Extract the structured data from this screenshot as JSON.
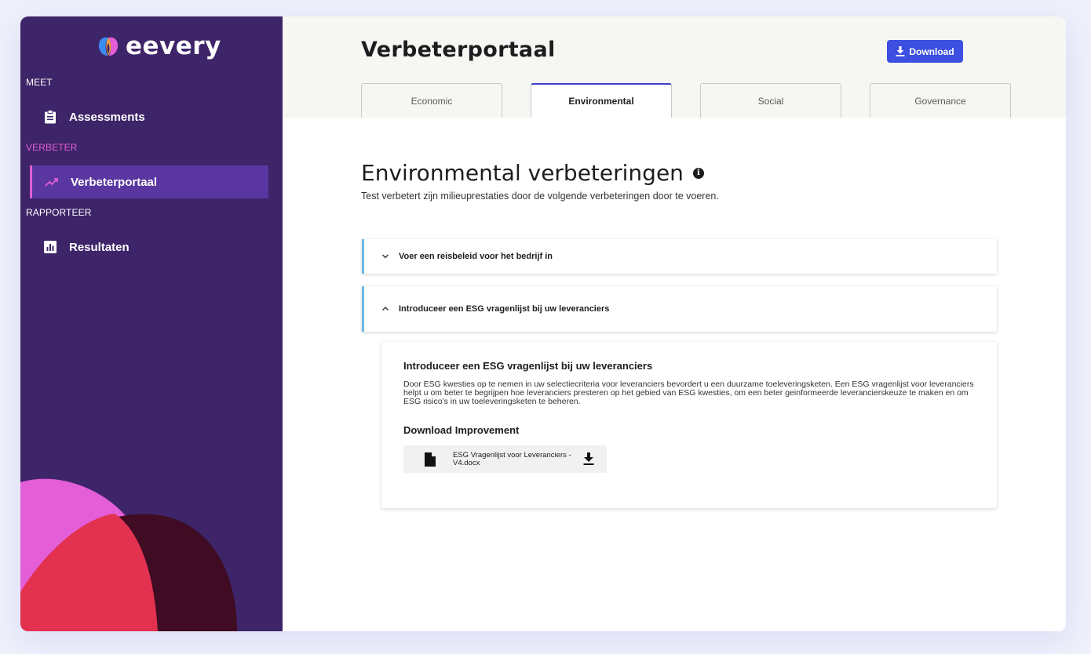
{
  "app": {
    "logo_text": "eevery"
  },
  "sidebar": {
    "sections": [
      {
        "label": "MEET",
        "color": "#ffffff"
      },
      {
        "label": "VERBETER",
        "color": "#e25ed7"
      },
      {
        "label": "RAPPORTEER",
        "color": "#ffffff"
      }
    ],
    "items": [
      {
        "label": "Assessments",
        "icon": "clipboard-icon",
        "active": false
      },
      {
        "label": "Verbeterportaal",
        "icon": "trending-up-icon",
        "active": true
      },
      {
        "label": "Resultaten",
        "icon": "bar-chart-icon",
        "active": false
      }
    ]
  },
  "header": {
    "title": "Verbeterportaal",
    "download_label": "Download"
  },
  "tabs": [
    {
      "label": "Economic",
      "active": false
    },
    {
      "label": "Environmental",
      "active": true
    },
    {
      "label": "Social",
      "active": false
    },
    {
      "label": "Governance",
      "active": false
    }
  ],
  "content": {
    "title": "Environmental verbeteringen",
    "subtitle": "Test verbetert zijn milieuprestaties door de volgende verbeteringen door te voeren.",
    "accordions": [
      {
        "label": "Voer een reisbeleid voor het bedrijf in",
        "expanded": false
      },
      {
        "label": "Introduceer een ESG vragenlijst bij uw leveranciers",
        "expanded": true
      }
    ],
    "detail": {
      "title": "Introduceer een ESG vragenlijst bij uw leveranciers",
      "text": "Door ESG kwesties op te nemen in uw selectiecriteria voor leveranciers bevordert u een duurzame toeleveringsketen. Een ESG vragenlijst voor leveranciers helpt u om beter te begrijpen hoe leveranciers presteren op het gebied van ESG kwesties, om een beter geinformeerde leverancierskeuze te maken en om ESG risico's in uw toeleveringsketen te beheren.",
      "download_heading": "Download Improvement",
      "file_name": "ESG Vragenlijst voor Leveranciers - V4.docx"
    }
  },
  "colors": {
    "sidebar_bg": "#3e2468",
    "active_item_bg": "#5a37a0",
    "accent_pink": "#e25ed7",
    "primary_blue": "#3c4fe0",
    "accordion_accent": "#6fb8e6"
  }
}
